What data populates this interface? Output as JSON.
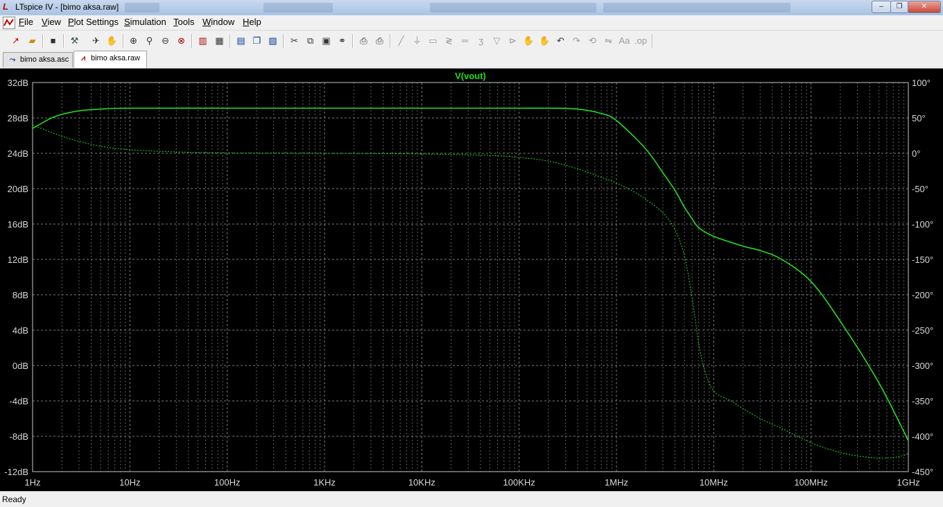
{
  "window": {
    "title": "LTspice IV - [bimo aksa.raw]",
    "controls": {
      "minimize": "–",
      "restore": "❐",
      "close": "✕"
    }
  },
  "menu": {
    "items": [
      {
        "key": "F",
        "rest": "ile"
      },
      {
        "key": "V",
        "rest": "iew"
      },
      {
        "key": "P",
        "rest": "lot Settings"
      },
      {
        "key": "S",
        "rest": "imulation"
      },
      {
        "key": "T",
        "rest": "ools"
      },
      {
        "key": "W",
        "rest": "indow"
      },
      {
        "key": "H",
        "rest": "elp"
      }
    ]
  },
  "tabs": [
    {
      "label": "bimo aksa.asc",
      "icon": "schematic-icon",
      "active": false
    },
    {
      "label": "bimo aksa.raw",
      "icon": "waveform-icon",
      "active": true
    }
  ],
  "status": {
    "text": "Ready"
  },
  "colors": {
    "trace": "#22dd22",
    "background": "#000000",
    "grid": "#7a7a7a",
    "axis_text": "#d8d8d8"
  },
  "chart_data": {
    "type": "line",
    "title": "V(vout)",
    "x_scale": "log",
    "x_unit": "Hz",
    "xlim": [
      1,
      1000000000
    ],
    "x_ticks": [
      "1Hz",
      "10Hz",
      "100Hz",
      "1KHz",
      "10KHz",
      "100KHz",
      "1MHz",
      "10MHz",
      "100MHz",
      "1GHz"
    ],
    "ylim_left": [
      -12,
      32
    ],
    "y_ticks_left": [
      "32dB",
      "28dB",
      "24dB",
      "20dB",
      "16dB",
      "12dB",
      "8dB",
      "4dB",
      "0dB",
      "-4dB",
      "-8dB",
      "-12dB"
    ],
    "ylim_right": [
      -450,
      100
    ],
    "y_ticks_right": [
      "100°",
      "50°",
      "0°",
      "-50°",
      "-100°",
      "-150°",
      "-200°",
      "-250°",
      "-300°",
      "-350°",
      "-400°",
      "-450°"
    ],
    "grid": true,
    "series": [
      {
        "kind": "magnitude",
        "axis": "left",
        "style": "solid",
        "x": [
          1,
          1.5,
          2,
          3,
          5,
          10,
          100,
          1000,
          10000,
          100000,
          200000,
          400000,
          700000,
          1000000,
          2000000,
          3000000,
          4000000,
          5000000,
          6000000,
          7000000,
          10000000,
          20000000,
          30000000,
          50000000,
          100000000,
          200000000,
          500000000,
          1000000000
        ],
        "values": [
          26.8,
          27.9,
          28.4,
          28.8,
          29.0,
          29.1,
          29.1,
          29.1,
          29.1,
          29.1,
          29.1,
          29.0,
          28.5,
          27.7,
          24.5,
          21.8,
          19.8,
          17.9,
          16.6,
          15.6,
          14.6,
          13.5,
          13.0,
          12.0,
          9.5,
          5.0,
          -2.0,
          -8.5
        ]
      },
      {
        "kind": "phase",
        "axis": "right",
        "style": "dotted",
        "x": [
          1,
          2,
          3,
          5,
          10,
          30,
          100,
          1000,
          10000,
          50000,
          100000,
          200000,
          400000,
          700000,
          1000000,
          1500000,
          2000000,
          3000000,
          4000000,
          5000000,
          6000000,
          7000000,
          8000000,
          10000000,
          15000000,
          20000000,
          30000000,
          50000000,
          100000000,
          200000000,
          400000000,
          700000000,
          1000000000
        ],
        "values": [
          40,
          24,
          17,
          10,
          5,
          2,
          0.5,
          0,
          -1,
          -3,
          -6,
          -11,
          -22,
          -34,
          -42,
          -54,
          -65,
          -84,
          -108,
          -145,
          -205,
          -268,
          -305,
          -336,
          -350,
          -361,
          -375,
          -389,
          -409,
          -423,
          -430,
          -430,
          -425
        ]
      }
    ]
  }
}
